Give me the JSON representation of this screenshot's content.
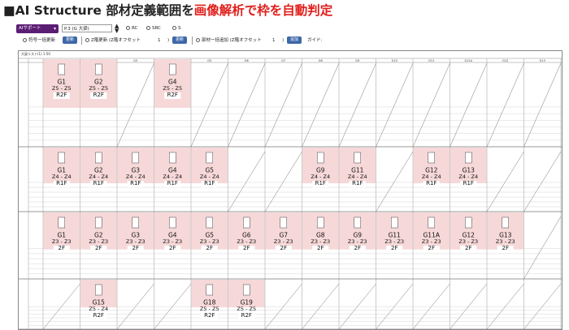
{
  "header": {
    "title_black": "■AI Structure 部材定義範囲を",
    "title_red": "画像解析で枠を自動判定"
  },
  "toolbar1": {
    "ai_button": "AIサポート",
    "select_value": "P.3 (G 大梁)",
    "radios": [
      "RC",
      "SRC",
      "S"
    ]
  },
  "toolbar2": {
    "item1": "符号一括更新",
    "item1_btn": "更新",
    "item2": "Z階更新 (Z階オフセット",
    "item2_val": "1",
    "item2_btn": "更新",
    "item3": "部材一括追加 (Z階オフセット",
    "item3_val": "1",
    "item3_btn": "追加",
    "item4": "ガイド:"
  },
  "sheet": {
    "label": "大梁リスト(1) 1:50",
    "col_headers": [
      "G1",
      "G2",
      "G3",
      "G4",
      "G5",
      "G6",
      "G7",
      "G8",
      "G9",
      "G10",
      "G11",
      "G11A",
      "G12",
      "G13"
    ],
    "bands": [
      {
        "floor": "R2F",
        "cells": [
          {
            "col": 0,
            "name": "G1",
            "size": "Z5 - Z5",
            "floor": "R2F",
            "hl": true
          },
          {
            "col": 1,
            "name": "G2",
            "size": "Z5 - Z5",
            "floor": "R2F",
            "hl": true
          },
          {
            "col": 3,
            "name": "G4",
            "size": "Z5 - Z5",
            "floor": "R2F",
            "hl": true
          }
        ]
      },
      {
        "floor": "R1F",
        "cells": [
          {
            "col": 0,
            "name": "G1",
            "size": "Z4 - Z4",
            "floor": "R1F",
            "hl": true
          },
          {
            "col": 1,
            "name": "G2",
            "size": "Z4 - Z4",
            "floor": "R1F",
            "hl": true
          },
          {
            "col": 2,
            "name": "G3",
            "size": "Z4 - Z4",
            "floor": "R1F",
            "hl": true
          },
          {
            "col": 3,
            "name": "G4",
            "size": "Z4 - Z4",
            "floor": "R1F",
            "hl": true
          },
          {
            "col": 4,
            "name": "G5",
            "size": "Z4 - Z4",
            "floor": "R1F",
            "hl": true
          },
          {
            "col": 7,
            "name": "G9",
            "size": "Z4 - Z4",
            "floor": "R1F",
            "hl": true
          },
          {
            "col": 8,
            "name": "G11",
            "size": "Z4 - Z4",
            "floor": "R1F",
            "hl": true
          },
          {
            "col": 10,
            "name": "G12",
            "size": "Z4 - Z4",
            "floor": "R1F",
            "hl": true
          },
          {
            "col": 11,
            "name": "G13",
            "size": "Z4 - Z4",
            "floor": "R1F",
            "hl": true
          }
        ]
      },
      {
        "floor": "2F",
        "cells": [
          {
            "col": 0,
            "name": "G1",
            "size": "Z3 - Z3",
            "floor": "2F",
            "hl": true
          },
          {
            "col": 1,
            "name": "G2",
            "size": "Z3 - Z3",
            "floor": "2F",
            "hl": true
          },
          {
            "col": 2,
            "name": "G3",
            "size": "Z3 - Z3",
            "floor": "2F",
            "hl": true
          },
          {
            "col": 3,
            "name": "G4",
            "size": "Z3 - Z3",
            "floor": "2F",
            "hl": true
          },
          {
            "col": 4,
            "name": "G5",
            "size": "Z3 - Z3",
            "floor": "2F",
            "hl": true
          },
          {
            "col": 5,
            "name": "G6",
            "size": "Z3 - Z3",
            "floor": "2F",
            "hl": true
          },
          {
            "col": 6,
            "name": "G7",
            "size": "Z3 - Z3",
            "floor": "2F",
            "hl": true
          },
          {
            "col": 7,
            "name": "G8",
            "size": "Z3 - Z3",
            "floor": "2F",
            "hl": true
          },
          {
            "col": 8,
            "name": "G9",
            "size": "Z3 - Z3",
            "floor": "2F",
            "hl": true
          },
          {
            "col": 9,
            "name": "G11",
            "size": "Z3 - Z3",
            "floor": "2F",
            "hl": true
          },
          {
            "col": 10,
            "name": "G11A",
            "size": "Z3 - Z3",
            "floor": "2F",
            "hl": true
          },
          {
            "col": 11,
            "name": "G12",
            "size": "Z3 - Z3",
            "floor": "2F",
            "hl": true
          },
          {
            "col": 12,
            "name": "G13",
            "size": "Z3 - Z3",
            "floor": "2F",
            "hl": true
          }
        ]
      },
      {
        "floor": "R2F",
        "cells": [
          {
            "col": 1,
            "name": "G15",
            "size": "Z5 - Z4",
            "floor": "R2F",
            "hl": true
          },
          {
            "col": 4,
            "name": "G18",
            "size": "Z5 - Z5",
            "floor": "R2F",
            "hl": true
          },
          {
            "col": 5,
            "name": "G19",
            "size": "Z5 - Z5",
            "floor": "R2F",
            "hl": true
          }
        ]
      }
    ]
  },
  "colors": {
    "accent_red": "#e0201c",
    "ai_purple": "#5b1d74",
    "button_blue": "#3d68a8",
    "highlight_pink": "#f6d8d8"
  }
}
